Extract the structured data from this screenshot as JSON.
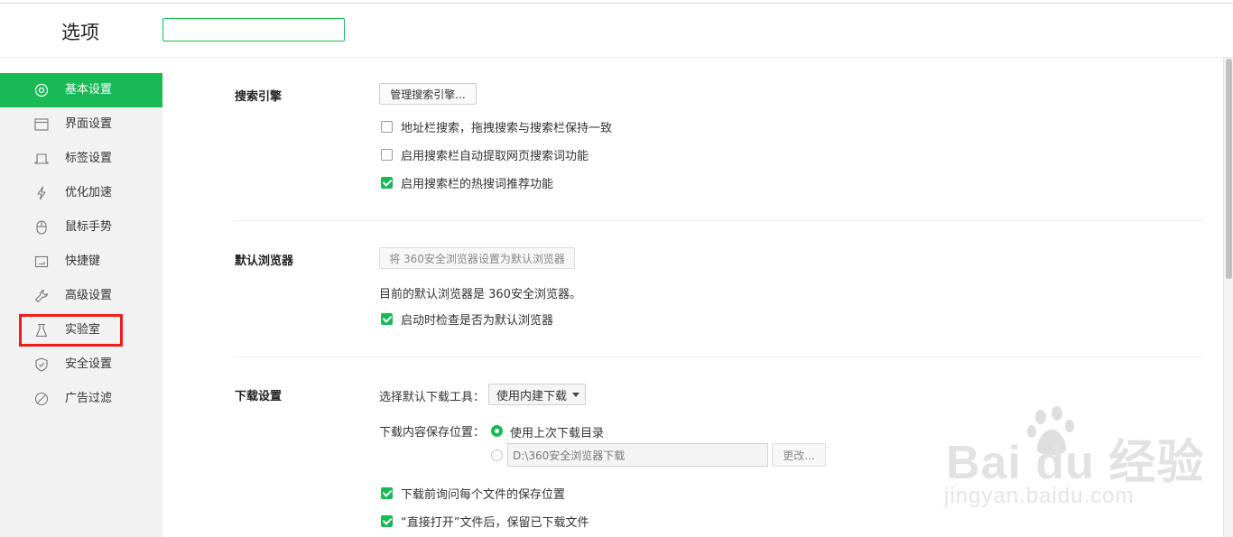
{
  "header": {
    "title": "选项",
    "search_value": ""
  },
  "sidebar": {
    "items": [
      {
        "label": "基本设置",
        "icon": "gear-icon",
        "active": true
      },
      {
        "label": "界面设置",
        "icon": "window-icon"
      },
      {
        "label": "标签设置",
        "icon": "tab-icon"
      },
      {
        "label": "优化加速",
        "icon": "lightning-icon"
      },
      {
        "label": "鼠标手势",
        "icon": "mouse-icon"
      },
      {
        "label": "快捷键",
        "icon": "keyboard-icon"
      },
      {
        "label": "高级设置",
        "icon": "wrench-icon"
      },
      {
        "label": "实验室",
        "icon": "flask-icon",
        "highlighted": true
      },
      {
        "label": "安全设置",
        "icon": "shield-icon"
      },
      {
        "label": "广告过滤",
        "icon": "block-icon"
      }
    ]
  },
  "search_engine": {
    "title": "搜索引擎",
    "manage_button": "管理搜索引擎...",
    "options": [
      {
        "label": "地址栏搜索，拖拽搜索与搜索栏保持一致",
        "checked": false
      },
      {
        "label": "启用搜索栏自动提取网页搜索词功能",
        "checked": false
      },
      {
        "label": "启用搜索栏的热搜词推荐功能",
        "checked": true
      }
    ]
  },
  "default_browser": {
    "title": "默认浏览器",
    "set_default_button": "将 360安全浏览器设置为默认浏览器",
    "status_text": "目前的默认浏览器是 360安全浏览器。",
    "check_option": {
      "label": "启动时检查是否为默认浏览器",
      "checked": true
    }
  },
  "download": {
    "title": "下载设置",
    "tool_label": "选择默认下载工具：",
    "tool_selected": "使用内建下载",
    "location_label": "下载内容保存位置：",
    "radio_last": "使用上次下载目录",
    "path_value": "D:\\360安全浏览器下载",
    "change_button": "更改...",
    "options": [
      {
        "label": "下载前询问每个文件的保存位置",
        "checked": true
      },
      {
        "label": "“直接打开”文件后，保留已下载文件",
        "checked": true
      }
    ]
  },
  "watermark": {
    "logo_text": "Bai du 经验",
    "url_text": "jingyan.baidu.com"
  },
  "colors": {
    "accent": "#19b955",
    "highlight_border": "#f01c1c",
    "sidebar_bg": "#f2f2f2"
  }
}
